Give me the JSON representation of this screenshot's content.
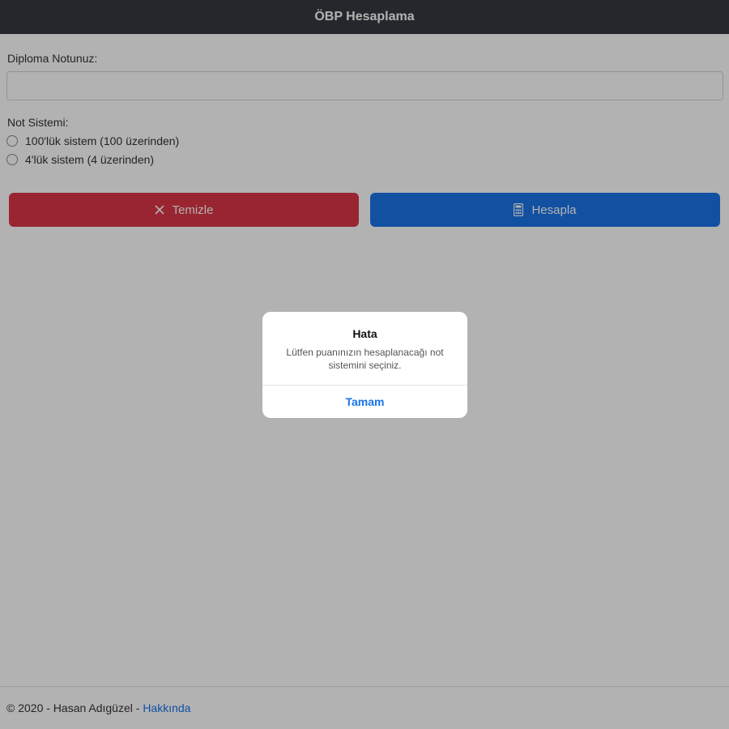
{
  "header": {
    "title": "ÖBP Hesaplama"
  },
  "form": {
    "diploma_label": "Diploma Notunuz:",
    "diploma_value": "",
    "system_label": "Not Sistemi:",
    "options": [
      {
        "label": "100'lük sistem (100 üzerinden)",
        "checked": false
      },
      {
        "label": "4'lük sistem (4 üzerinden)",
        "checked": false
      }
    ]
  },
  "buttons": {
    "clear_label": "Temizle",
    "clear_icon": "close-icon",
    "calc_label": "Hesapla",
    "calc_icon": "calculator-icon"
  },
  "footer": {
    "copyright": "© 2020 - Hasan Adıgüzel - ",
    "link_label": "Hakkında"
  },
  "dialog": {
    "title": "Hata",
    "message": "Lütfen puanınızın hesaplanacağı not sistemini seçiniz.",
    "ok_label": "Tamam"
  },
  "colors": {
    "topbar": "#343a40",
    "clear_button": "#dc3545",
    "calc_button": "#1a73e8",
    "link": "#1a73e8"
  }
}
